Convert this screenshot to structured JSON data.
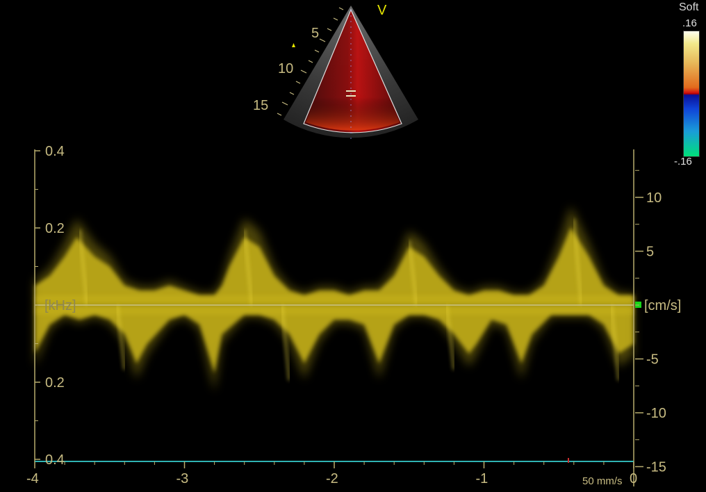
{
  "colorbar": {
    "label": "Soft",
    "max": ".16",
    "min": "-.16"
  },
  "sector": {
    "mode_marker": "V",
    "depth_ticks": [
      "5",
      "10",
      "15"
    ]
  },
  "left_axis": {
    "unit": "[kHz]",
    "ticks": [
      {
        "label": "0.4",
        "value": 0.4
      },
      {
        "label": "0.2",
        "value": 0.2
      },
      {
        "label": "0.2",
        "value": -0.2
      },
      {
        "label": "0.4",
        "value": -0.4
      }
    ]
  },
  "right_axis": {
    "unit": "[cm/s]",
    "ticks": [
      {
        "label": "10",
        "value": 10
      },
      {
        "label": "5",
        "value": 5
      },
      {
        "label": "-5",
        "value": -5
      },
      {
        "label": "-10",
        "value": -10
      },
      {
        "label": "-15",
        "value": -15
      }
    ]
  },
  "time_axis": {
    "ticks": [
      {
        "label": "-4",
        "value": -4
      },
      {
        "label": "-3",
        "value": -3
      },
      {
        "label": "-2",
        "value": -2
      },
      {
        "label": "-1",
        "value": -1
      },
      {
        "label": "0",
        "value": 0
      }
    ]
  },
  "sweep_speed": "50 mm/s",
  "colors": {
    "spectrum": "#d9c21a",
    "axis": "#b8ad6e",
    "baseline": "#c9c48a",
    "bottom_line": "#2fb3b3",
    "marker_green": "#19d619"
  },
  "chart_data": {
    "type": "spectral_doppler",
    "xlabel": "",
    "xlim": [
      -4,
      0
    ],
    "left_ylabel": "[kHz]",
    "left_ylim": [
      -0.4,
      0.4
    ],
    "right_ylabel": "[cm/s]",
    "right_ylim": [
      -15,
      15
    ],
    "beats": [
      {
        "t": -3.7,
        "pos_peak": 7,
        "neg_peak": -6
      },
      {
        "t": -2.6,
        "pos_peak": 7,
        "neg_peak": -7
      },
      {
        "t": -1.5,
        "pos_peak": 6,
        "neg_peak": -6
      },
      {
        "t": -0.4,
        "pos_peak": 8,
        "neg_peak": -7
      }
    ],
    "envelope_pos": [
      [
        -4.0,
        2
      ],
      [
        -3.9,
        3
      ],
      [
        -3.8,
        5
      ],
      [
        -3.72,
        7
      ],
      [
        -3.6,
        5
      ],
      [
        -3.5,
        4
      ],
      [
        -3.4,
        2
      ],
      [
        -3.3,
        1.5
      ],
      [
        -3.2,
        1.5
      ],
      [
        -3.1,
        2
      ],
      [
        -3.0,
        1.5
      ],
      [
        -2.9,
        1
      ],
      [
        -2.8,
        1
      ],
      [
        -2.75,
        2
      ],
      [
        -2.7,
        4
      ],
      [
        -2.6,
        7
      ],
      [
        -2.5,
        6
      ],
      [
        -2.4,
        3
      ],
      [
        -2.3,
        1.5
      ],
      [
        -2.2,
        1
      ],
      [
        -2.1,
        1.5
      ],
      [
        -2.0,
        1.5
      ],
      [
        -1.9,
        1
      ],
      [
        -1.8,
        1.5
      ],
      [
        -1.7,
        1.5
      ],
      [
        -1.6,
        3
      ],
      [
        -1.5,
        6
      ],
      [
        -1.4,
        5
      ],
      [
        -1.3,
        3
      ],
      [
        -1.2,
        1.5
      ],
      [
        -1.1,
        1
      ],
      [
        -1.0,
        1.5
      ],
      [
        -0.9,
        1.5
      ],
      [
        -0.8,
        1
      ],
      [
        -0.7,
        1
      ],
      [
        -0.6,
        2
      ],
      [
        -0.5,
        5
      ],
      [
        -0.42,
        8
      ],
      [
        -0.3,
        5
      ],
      [
        -0.2,
        2
      ],
      [
        -0.1,
        1
      ],
      [
        0,
        1
      ]
    ],
    "envelope_neg": [
      [
        -4.0,
        -5
      ],
      [
        -3.9,
        -2
      ],
      [
        -3.8,
        -1
      ],
      [
        -3.7,
        -1.5
      ],
      [
        -3.6,
        -1
      ],
      [
        -3.5,
        -1.5
      ],
      [
        -3.4,
        -3
      ],
      [
        -3.32,
        -6
      ],
      [
        -3.25,
        -4
      ],
      [
        -3.1,
        -1.5
      ],
      [
        -3.0,
        -1
      ],
      [
        -2.9,
        -2
      ],
      [
        -2.8,
        -7
      ],
      [
        -2.75,
        -3
      ],
      [
        -2.6,
        -1
      ],
      [
        -2.5,
        -1
      ],
      [
        -2.4,
        -1.5
      ],
      [
        -2.3,
        -3
      ],
      [
        -2.2,
        -6
      ],
      [
        -2.1,
        -3
      ],
      [
        -2.0,
        -1.5
      ],
      [
        -1.9,
        -1.5
      ],
      [
        -1.8,
        -2
      ],
      [
        -1.7,
        -6
      ],
      [
        -1.6,
        -2
      ],
      [
        -1.5,
        -1
      ],
      [
        -1.4,
        -1
      ],
      [
        -1.3,
        -1.5
      ],
      [
        -1.2,
        -3
      ],
      [
        -1.1,
        -5
      ],
      [
        -1.05,
        -4
      ],
      [
        -0.95,
        -1.5
      ],
      [
        -0.85,
        -2
      ],
      [
        -0.75,
        -6
      ],
      [
        -0.68,
        -3
      ],
      [
        -0.55,
        -1
      ],
      [
        -0.4,
        -1
      ],
      [
        -0.3,
        -1
      ],
      [
        -0.2,
        -2
      ],
      [
        -0.1,
        -5
      ],
      [
        0,
        -4
      ]
    ]
  }
}
